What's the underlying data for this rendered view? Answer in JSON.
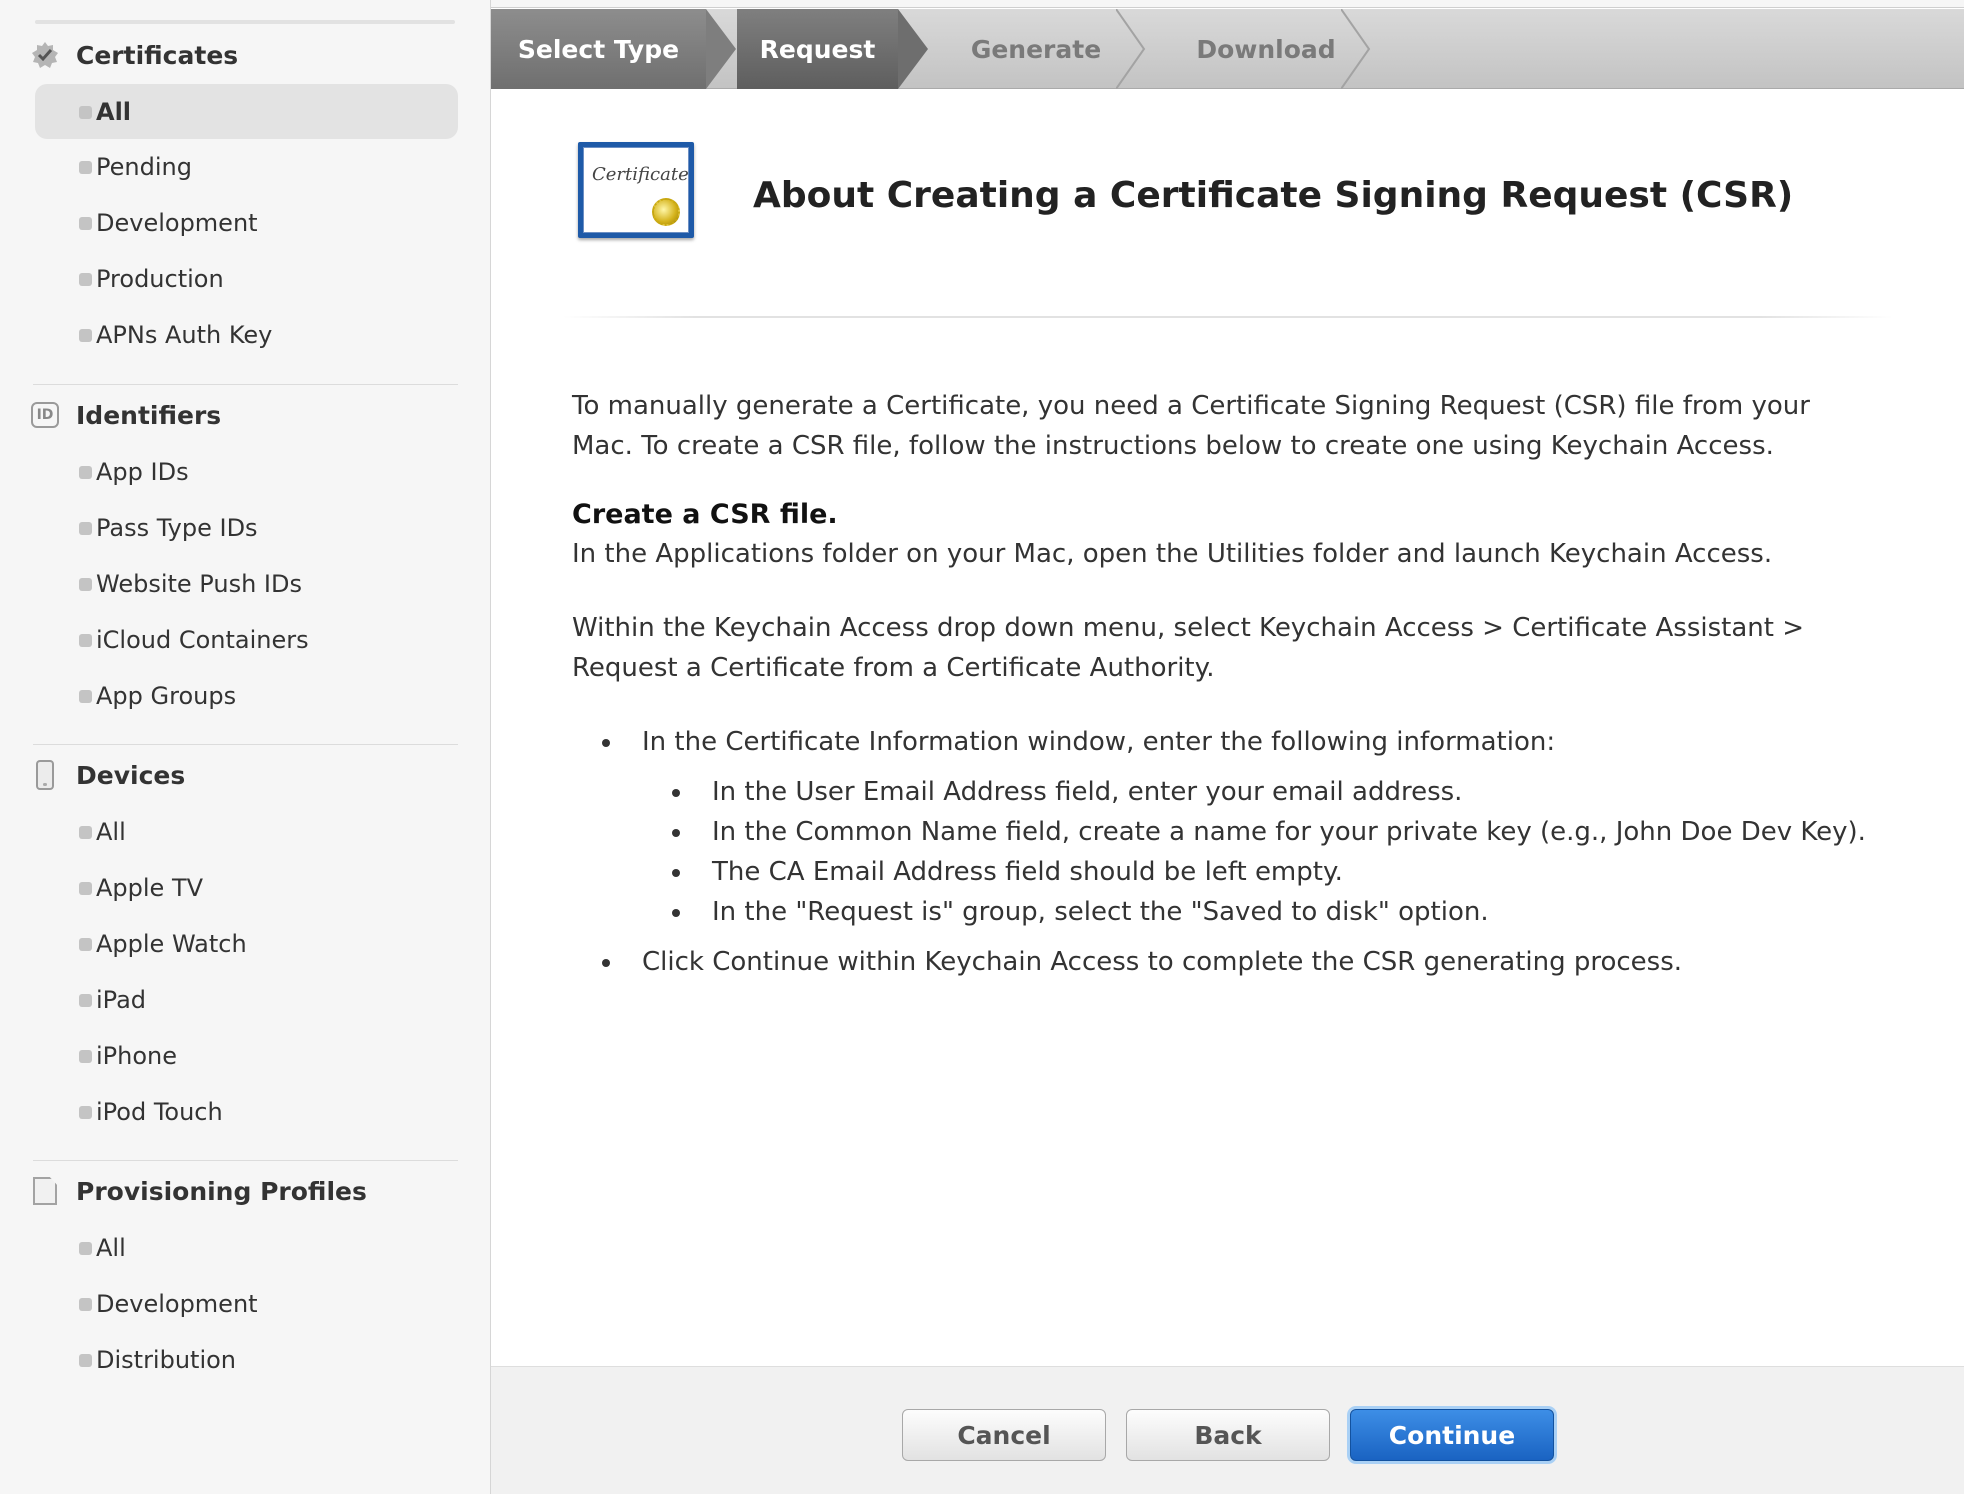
{
  "sidebar": {
    "sections": [
      {
        "title": "Certificates",
        "icon": "certificate-seal-icon",
        "items": [
          "All",
          "Pending",
          "Development",
          "Production",
          "APNs Auth Key"
        ],
        "active": "All"
      },
      {
        "title": "Identifiers",
        "icon": "id-badge-icon",
        "badge": "ID",
        "items": [
          "App IDs",
          "Pass Type IDs",
          "Website Push IDs",
          "iCloud Containers",
          "App Groups"
        ]
      },
      {
        "title": "Devices",
        "icon": "phone-icon",
        "items": [
          "All",
          "Apple TV",
          "Apple Watch",
          "iPad",
          "iPhone",
          "iPod Touch"
        ]
      },
      {
        "title": "Provisioning Profiles",
        "icon": "document-icon",
        "items": [
          "All",
          "Development",
          "Distribution"
        ]
      }
    ]
  },
  "steps": [
    {
      "label": "Select Type",
      "state": "done"
    },
    {
      "label": "Request",
      "state": "current"
    },
    {
      "label": "Generate",
      "state": "upcoming"
    },
    {
      "label": "Download",
      "state": "upcoming"
    }
  ],
  "main": {
    "cert_icon_text": "Certificate",
    "title": "About Creating a Certificate Signing Request (CSR)",
    "intro": "To manually generate a Certificate, you need a Certificate Signing Request (CSR) file from your Mac. To create a CSR file, follow the instructions below to create one using Keychain Access.",
    "subheading": "Create a CSR file.",
    "step_open": "In the Applications folder on your Mac, open the Utilities folder and launch Keychain Access.",
    "step_menu": "Within the Keychain Access drop down menu, select Keychain Access > Certificate Assistant > Request a Certificate from a Certificate Authority.",
    "bullet_1": "In the Certificate Information window, enter the following information:",
    "sub_bullets": [
      "In the User Email Address field, enter your email address.",
      "In the Common Name field, create a name for your private key (e.g., John Doe Dev Key).",
      "The CA Email Address field should be left empty.",
      "In the \"Request is\" group, select the \"Saved to disk\" option."
    ],
    "bullet_2": "Click Continue within Keychain Access to complete the CSR generating process."
  },
  "footer": {
    "cancel": "Cancel",
    "back": "Back",
    "continue": "Continue"
  },
  "colors": {
    "primary_button": "#1a63c2",
    "step_active": "#6a6a6a",
    "step_inactive": "#c8c8c8"
  }
}
